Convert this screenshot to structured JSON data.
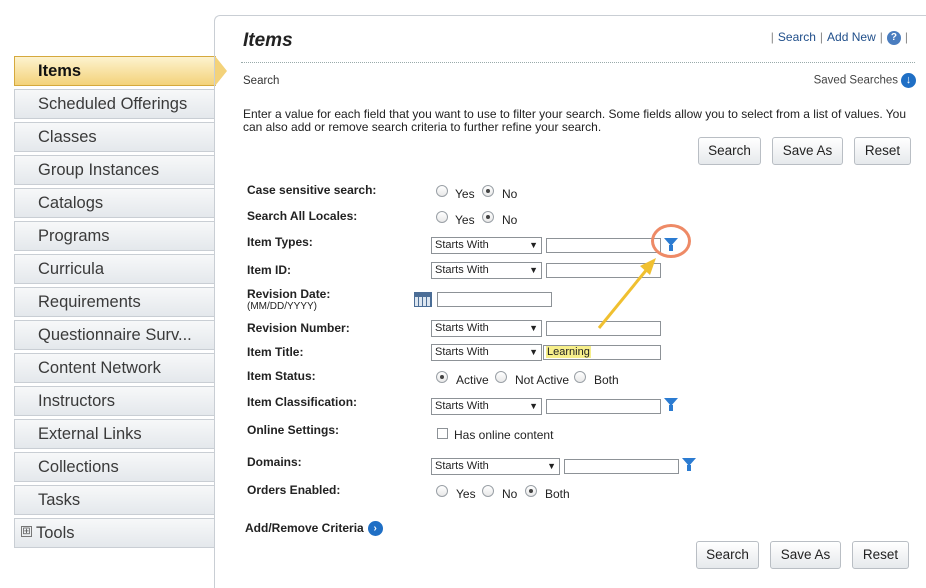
{
  "nav": {
    "items": [
      {
        "label": "Items"
      },
      {
        "label": "Scheduled Offerings"
      },
      {
        "label": "Classes"
      },
      {
        "label": "Group Instances"
      },
      {
        "label": "Catalogs"
      },
      {
        "label": "Programs"
      },
      {
        "label": "Curricula"
      },
      {
        "label": "Requirements"
      },
      {
        "label": "Questionnaire Surv..."
      },
      {
        "label": "Content Network"
      },
      {
        "label": "Instructors"
      },
      {
        "label": "External Links"
      },
      {
        "label": "Collections"
      },
      {
        "label": "Tasks"
      },
      {
        "label": "Tools",
        "expander": "⊞"
      }
    ],
    "active_index": 0
  },
  "header": {
    "title": "Items",
    "links": {
      "search": "Search",
      "add_new": "Add New",
      "separator": "|"
    },
    "help_icon": "?"
  },
  "section": {
    "subtitle": "Search",
    "saved_searches": "Saved Searches",
    "saved_icon": "↓",
    "description": "Enter a value for each field that you want to use to filter your search. Some fields allow you to select from a list of values. You can also add or remove search criteria to further refine your search."
  },
  "buttons": {
    "search": "Search",
    "save_as": "Save As",
    "reset": "Reset"
  },
  "form": {
    "case_sensitive": {
      "label": "Case sensitive search:",
      "yes": "Yes",
      "no": "No",
      "selected": "No"
    },
    "all_locales": {
      "label": "Search All Locales:",
      "yes": "Yes",
      "no": "No",
      "selected": "No"
    },
    "item_types": {
      "label": "Item Types:",
      "operator": "Starts With",
      "value": ""
    },
    "item_id": {
      "label": "Item ID:",
      "operator": "Starts With",
      "value": ""
    },
    "revision_date": {
      "label": "Revision Date:",
      "hint": "(MM/DD/YYYY)",
      "value": ""
    },
    "revision_number": {
      "label": "Revision Number:",
      "operator": "Starts With",
      "value": ""
    },
    "item_title": {
      "label": "Item Title:",
      "operator": "Starts With",
      "value": "Learning"
    },
    "item_status": {
      "label": "Item Status:",
      "active": "Active",
      "not_active": "Not Active",
      "both": "Both",
      "selected": "Active"
    },
    "item_classification": {
      "label": "Item Classification:",
      "operator": "Starts With",
      "value": ""
    },
    "online_settings": {
      "label": "Online Settings:",
      "checkbox": "Has online content",
      "checked": false
    },
    "domains": {
      "label": "Domains:",
      "operator": "Starts With",
      "value": ""
    },
    "orders_enabled": {
      "label": "Orders Enabled:",
      "yes": "Yes",
      "no": "No",
      "both": "Both",
      "selected": "Both"
    }
  },
  "add_remove": {
    "label": "Add/Remove Criteria",
    "icon": "›"
  },
  "annotation": {
    "color": "#ee8a66",
    "arrow_color": "#f0c030"
  }
}
